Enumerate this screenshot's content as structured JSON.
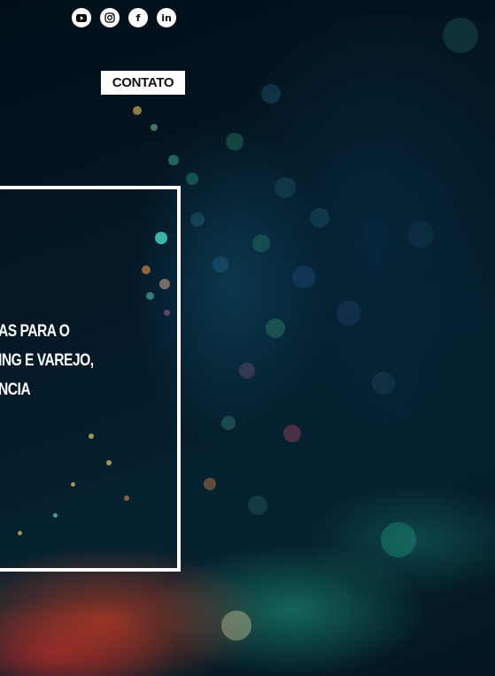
{
  "social": {
    "items": [
      {
        "name": "youtube",
        "icon": "youtube-icon"
      },
      {
        "name": "instagram",
        "icon": "instagram-icon"
      },
      {
        "name": "facebook",
        "icon": "facebook-icon",
        "glyph": "f"
      },
      {
        "name": "linkedin",
        "icon": "linkedin-icon",
        "glyph": "in"
      }
    ]
  },
  "header": {
    "contact_label": "CONTATO"
  },
  "hero": {
    "lines": [
      "AS PARA O",
      "ING E VAREJO,",
      "NCIA"
    ]
  },
  "colors": {
    "background": "#03121c",
    "frame": "#ffffff",
    "button_bg": "#ffffff",
    "button_text": "#111111"
  }
}
